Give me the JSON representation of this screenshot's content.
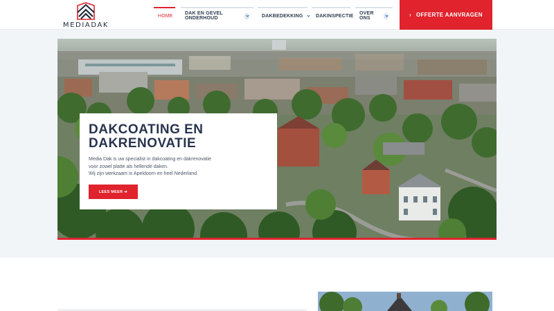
{
  "brand": {
    "name": "MEDIADAK",
    "accent": "#e0232d",
    "dark": "#28344f"
  },
  "nav": {
    "items": [
      {
        "label": "HOME",
        "active": true,
        "dropdown": false
      },
      {
        "label": "DAK EN GEVEL ONDERHOUD",
        "active": false,
        "dropdown": true
      },
      {
        "label": "DAKBEDEKKING",
        "active": false,
        "dropdown": true
      },
      {
        "label": "DAKINSPECTIE",
        "active": false,
        "dropdown": false
      },
      {
        "label": "OVER ONS",
        "active": false,
        "dropdown": true
      }
    ]
  },
  "cta": {
    "label": "OFFERTE AANVRAGEN",
    "icon": "chevron-right-icon"
  },
  "hero": {
    "title": "DAKCOATING EN DAKRENOVATIE",
    "text_line_1": "Media Dak is uw specialist in dakcoating en dakrenovatie",
    "text_line_2": "voor zowel platte als hellende daken.",
    "text_line_3": "Wij zijn werkzaam in Apeldoorn en heel Nederland.",
    "button_label": "LEES MEER ➔"
  }
}
